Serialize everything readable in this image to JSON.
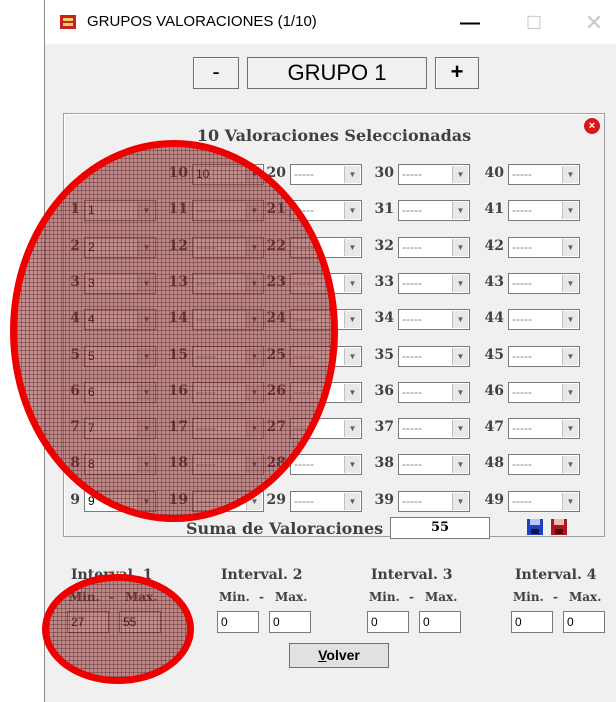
{
  "window": {
    "title": "GRUPOS VALORACIONES (1/10)",
    "min_glyph": "—",
    "max_glyph": "☐",
    "close_glyph": "✕",
    "app_icon": "red-app-icon"
  },
  "nav": {
    "minus": "-",
    "group": "GRUPO 1",
    "plus": "+"
  },
  "panel": {
    "title": "10  Valoraciones Seleccionadas",
    "close_icon": "close-circle-icon",
    "close_glyph": "×"
  },
  "columns": [
    [
      {
        "n": "1",
        "v": "1"
      },
      {
        "n": "2",
        "v": "2"
      },
      {
        "n": "3",
        "v": "3"
      },
      {
        "n": "4",
        "v": "4"
      },
      {
        "n": "5",
        "v": "5"
      },
      {
        "n": "6",
        "v": "6"
      },
      {
        "n": "7",
        "v": "7"
      },
      {
        "n": "8",
        "v": "8"
      },
      {
        "n": "9",
        "v": "9"
      }
    ],
    [
      {
        "n": "10",
        "v": "10"
      },
      {
        "n": "11",
        "v": "-----"
      },
      {
        "n": "12",
        "v": "-----"
      },
      {
        "n": "13",
        "v": "-----"
      },
      {
        "n": "14",
        "v": "-----"
      },
      {
        "n": "15",
        "v": "-----"
      },
      {
        "n": "16",
        "v": "-----"
      },
      {
        "n": "17",
        "v": "-----"
      },
      {
        "n": "18",
        "v": "-----"
      },
      {
        "n": "19",
        "v": "-----"
      }
    ],
    [
      {
        "n": "20",
        "v": "-----"
      },
      {
        "n": "21",
        "v": "-----"
      },
      {
        "n": "22",
        "v": "-----"
      },
      {
        "n": "23",
        "v": "-----"
      },
      {
        "n": "24",
        "v": "-----"
      },
      {
        "n": "25",
        "v": "-----"
      },
      {
        "n": "26",
        "v": "-----"
      },
      {
        "n": "27",
        "v": "-----"
      },
      {
        "n": "28",
        "v": "-----"
      },
      {
        "n": "29",
        "v": "-----"
      }
    ],
    [
      {
        "n": "30",
        "v": "-----"
      },
      {
        "n": "31",
        "v": "-----"
      },
      {
        "n": "32",
        "v": "-----"
      },
      {
        "n": "33",
        "v": "-----"
      },
      {
        "n": "34",
        "v": "-----"
      },
      {
        "n": "35",
        "v": "-----"
      },
      {
        "n": "36",
        "v": "-----"
      },
      {
        "n": "37",
        "v": "-----"
      },
      {
        "n": "38",
        "v": "-----"
      },
      {
        "n": "39",
        "v": "-----"
      }
    ],
    [
      {
        "n": "40",
        "v": "-----"
      },
      {
        "n": "41",
        "v": "-----"
      },
      {
        "n": "42",
        "v": "-----"
      },
      {
        "n": "43",
        "v": "-----"
      },
      {
        "n": "44",
        "v": "-----"
      },
      {
        "n": "45",
        "v": "-----"
      },
      {
        "n": "46",
        "v": "-----"
      },
      {
        "n": "47",
        "v": "-----"
      },
      {
        "n": "48",
        "v": "-----"
      },
      {
        "n": "49",
        "v": "-----"
      }
    ]
  ],
  "sum": {
    "label": "Suma de Valoraciones :",
    "value": "55",
    "save_icons": [
      "blue-floppy-icon",
      "red-floppy-icon"
    ]
  },
  "intervals": [
    {
      "label": "Interval. 1",
      "min_label": "Min.",
      "sep": "-",
      "max_label": "Max.",
      "min": "27",
      "max": "55"
    },
    {
      "label": "Interval. 2",
      "min_label": "Min.",
      "sep": "-",
      "max_label": "Max.",
      "min": "0",
      "max": "0"
    },
    {
      "label": "Interval. 3",
      "min_label": "Min.",
      "sep": "-",
      "max_label": "Max.",
      "min": "0",
      "max": "0"
    },
    {
      "label": "Interval. 4",
      "min_label": "Min.",
      "sep": "-",
      "max_label": "Max.",
      "min": "0",
      "max": "0"
    }
  ],
  "volver": {
    "first": "V",
    "rest": "olver"
  },
  "colors": {
    "annotation": "#ee0000",
    "overlay_fill": "#963232",
    "window_bg": "#f0f0f0"
  }
}
